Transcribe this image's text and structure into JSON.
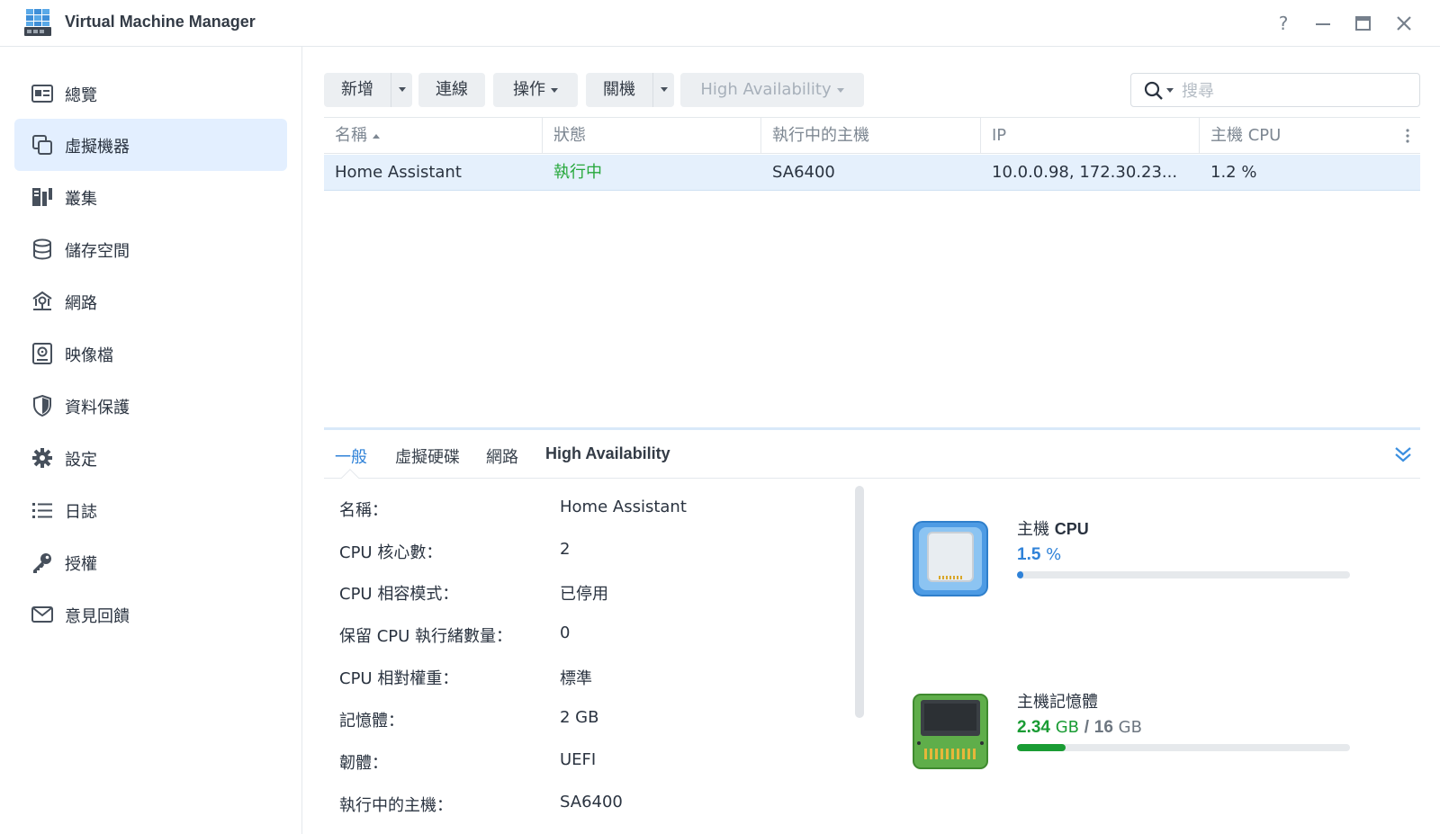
{
  "window": {
    "title": "Virtual Machine Manager",
    "help_label": "?",
    "minimize_label": "—",
    "maximize_label": "▭",
    "close_label": "✕"
  },
  "sidebar": {
    "items": [
      {
        "label": "總覽",
        "icon": "overview-icon"
      },
      {
        "label": "虛擬機器",
        "icon": "virtual-machine-icon",
        "active": true
      },
      {
        "label": "叢集",
        "icon": "cluster-icon"
      },
      {
        "label": "儲存空間",
        "icon": "storage-icon"
      },
      {
        "label": "網路",
        "icon": "network-icon"
      },
      {
        "label": "映像檔",
        "icon": "image-icon"
      },
      {
        "label": "資料保護",
        "icon": "shield-icon"
      },
      {
        "label": "設定",
        "icon": "gear-icon"
      },
      {
        "label": "日誌",
        "icon": "log-icon"
      },
      {
        "label": "授權",
        "icon": "key-icon"
      },
      {
        "label": "意見回饋",
        "icon": "mail-icon"
      }
    ]
  },
  "toolbar": {
    "add_label": "新增",
    "connect_label": "連線",
    "action_label": "操作",
    "shutdown_label": "關機",
    "ha_label": "High Availability"
  },
  "search": {
    "placeholder": "搜尋"
  },
  "table": {
    "columns": [
      "名稱",
      "狀態",
      "執行中的主機",
      "IP",
      "主機 CPU"
    ],
    "rows": [
      {
        "name": "Home Assistant",
        "status": "執行中",
        "host": "SA6400",
        "ip": "10.0.0.98, 172.30.23...",
        "cpu": "1.2 %"
      }
    ]
  },
  "detail": {
    "tabs": [
      "一般",
      "虛擬硬碟",
      "網路",
      "High Availability"
    ],
    "properties": [
      {
        "label": "名稱：",
        "value": "Home Assistant"
      },
      {
        "label": "CPU 核心數：",
        "value": "2"
      },
      {
        "label": "CPU 相容模式：",
        "value": "已停用"
      },
      {
        "label": "保留 CPU 執行緒數量：",
        "value": "0"
      },
      {
        "label": "CPU 相對權重：",
        "value": "標準"
      },
      {
        "label": "記憶體：",
        "value": "2 GB"
      },
      {
        "label": "韌體：",
        "value": "UEFI"
      },
      {
        "label": "執行中的主機：",
        "value": "SA6400"
      }
    ],
    "cpu": {
      "title_prefix": "主機",
      "title_bold": "CPU",
      "value": "1.5",
      "unit": "%",
      "usage_fraction": 0.015
    },
    "memory": {
      "title": "主機記憶體",
      "used": "2.34",
      "used_unit": "GB",
      "separator": "/",
      "total": "16",
      "total_unit": "GB",
      "usage_fraction": 0.146
    }
  },
  "colors": {
    "accent": "#2f82d8",
    "running": "#27a83c",
    "memory": "#1a9c34",
    "selected_row": "#e5f0fc",
    "active_nav": "#e3efff"
  }
}
